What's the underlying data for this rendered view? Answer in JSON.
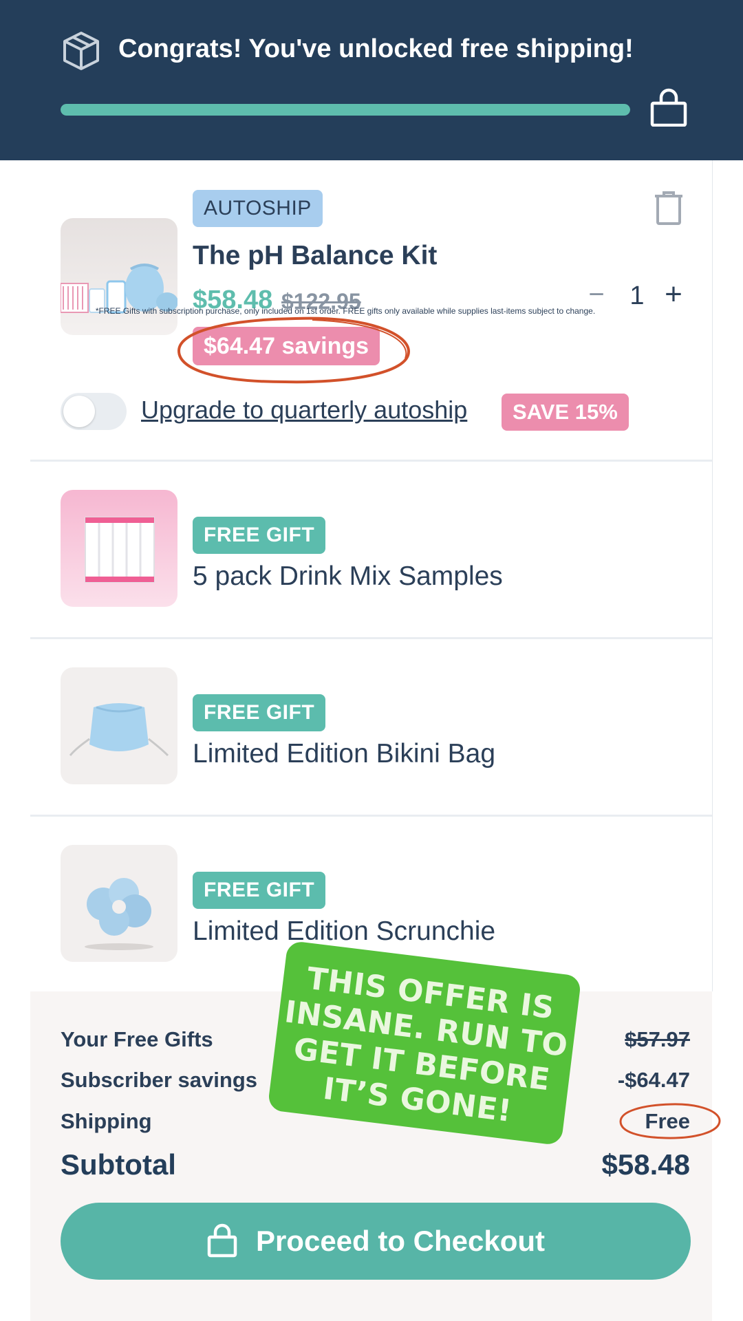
{
  "banner": {
    "title": "Congrats! You've unlocked free shipping!",
    "progress_percent": 100,
    "icons": [
      "package-icon",
      "shopping-bag-icon"
    ]
  },
  "colors": {
    "banner_bg": "#243e5a",
    "accent_teal": "#5ebdad",
    "pink": "#ec8dad",
    "autoship_blue": "#a8cdee",
    "sticker_green": "#55c13a",
    "annotation_red": "#d2512a"
  },
  "items": [
    {
      "tag": "AUTOSHIP",
      "name": "The pH Balance Kit",
      "price": "$58.48",
      "old_price": "$122.95",
      "savings": "$64.47 savings",
      "quantity": "1",
      "qty_minus": "−",
      "qty_plus": "+",
      "upgrade_text": "Upgrade to quarterly autoship",
      "upgrade_badge": "SAVE 15%",
      "toggle_on": false
    },
    {
      "tag": "FREE GIFT",
      "name": "5 pack Drink Mix Samples"
    },
    {
      "tag": "FREE GIFT",
      "name": "Limited Edition Bikini Bag"
    },
    {
      "tag": "FREE GIFT",
      "name": "Limited Edition Scrunchie"
    }
  ],
  "summary": {
    "free_gifts_label": "Your Free Gifts",
    "free_gifts_value": "$57.97",
    "subscriber_label": "Subscriber savings",
    "subscriber_value": "-$64.47",
    "shipping_label": "Shipping",
    "shipping_value": "Free",
    "subtotal_label": "Subtotal",
    "subtotal_value": "$58.48"
  },
  "checkout": {
    "label": "Proceed to Checkout"
  },
  "disclaimer": "*FREE Gifts with subscription purchase, only included on 1st order. FREE gifts only available while supplies last-items subject to change.",
  "sticker": {
    "lines": [
      "THIS OFFER IS",
      "INSANE. RUN TO",
      "GET IT BEFORE",
      "IT’S GONE!"
    ]
  }
}
